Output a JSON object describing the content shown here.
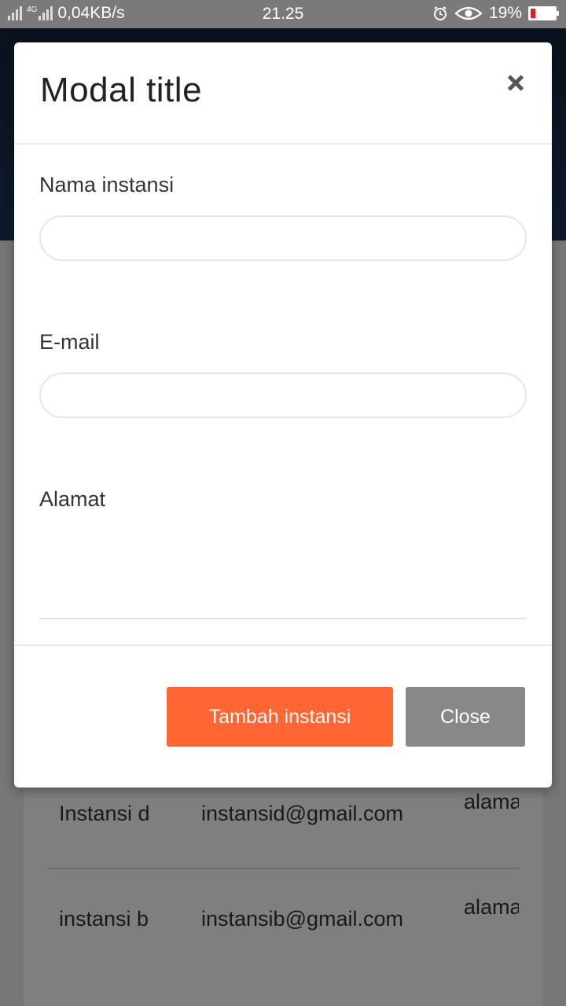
{
  "status_bar": {
    "network_speed": "0,04KB/s",
    "network_type": "4G",
    "time": "21.25",
    "battery": "19%",
    "battery_level": 0.19
  },
  "table": {
    "rows": [
      {
        "name": "Instansi d",
        "email": "instansid@gmail.com",
        "address": "alamat instansi"
      },
      {
        "name": "instansi b",
        "email": "instansib@gmail.com",
        "address": "alamat instansi"
      }
    ]
  },
  "modal": {
    "title": "Modal title",
    "fields": {
      "name_label": "Nama instansi",
      "name_value": "",
      "email_label": "E-mail",
      "email_value": "",
      "address_label": "Alamat",
      "address_value": ""
    },
    "footer": {
      "submit_label": "Tambah instansi",
      "close_label": "Close"
    }
  },
  "colors": {
    "primary_button": "#ff6633",
    "secondary_button": "#888888",
    "header_bg": "#1d3558",
    "battery_low": "#e31b1b"
  },
  "icons": [
    "alarm-icon",
    "eye-icon",
    "close-icon",
    "signal-icon",
    "battery-icon"
  ]
}
